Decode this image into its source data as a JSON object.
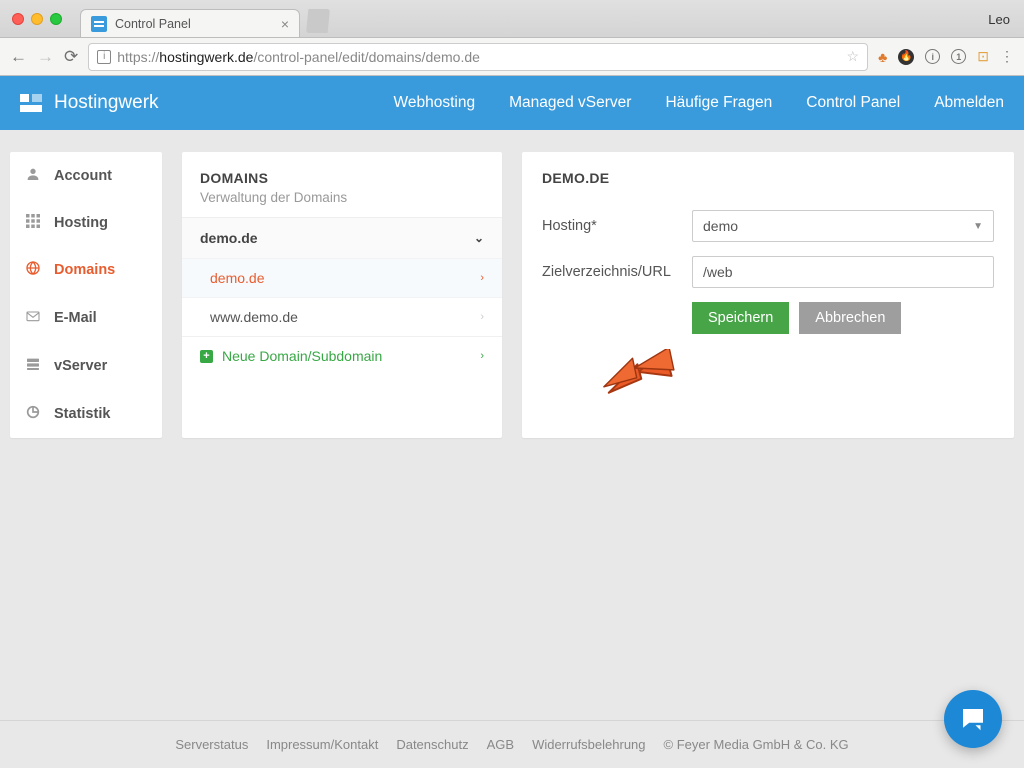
{
  "browser": {
    "tab_title": "Control Panel",
    "profile": "Leo",
    "url_protocol": "https://",
    "url_host": "hostingwerk.de",
    "url_path": "/control-panel/edit/domains/demo.de"
  },
  "brand": "Hostingwerk",
  "nav": [
    "Webhosting",
    "Managed vServer",
    "Häufige Fragen",
    "Control Panel",
    "Abmelden"
  ],
  "sidebar": {
    "items": [
      {
        "label": "Account",
        "icon": "person"
      },
      {
        "label": "Hosting",
        "icon": "grid"
      },
      {
        "label": "Domains",
        "icon": "globe",
        "active": true
      },
      {
        "label": "E-Mail",
        "icon": "mail"
      },
      {
        "label": "vServer",
        "icon": "server"
      },
      {
        "label": "Statistik",
        "icon": "chart"
      }
    ]
  },
  "domains_panel": {
    "title": "DOMAINS",
    "subtitle": "Verwaltung der Domains",
    "group": "demo.de",
    "rows": [
      {
        "label": "demo.de",
        "active": true
      },
      {
        "label": "www.demo.de",
        "active": false
      }
    ],
    "add_label": "Neue Domain/Subdomain"
  },
  "form": {
    "title": "DEMO.DE",
    "hosting_label": "Hosting*",
    "hosting_value": "demo",
    "dir_label": "Zielverzeichnis/URL",
    "dir_value": "/web",
    "save": "Speichern",
    "cancel": "Abbrechen"
  },
  "footer": {
    "links": [
      "Serverstatus",
      "Impressum/Kontakt",
      "Datenschutz",
      "AGB",
      "Widerrufsbelehrung"
    ],
    "copyright": "© Feyer Media GmbH & Co. KG"
  }
}
